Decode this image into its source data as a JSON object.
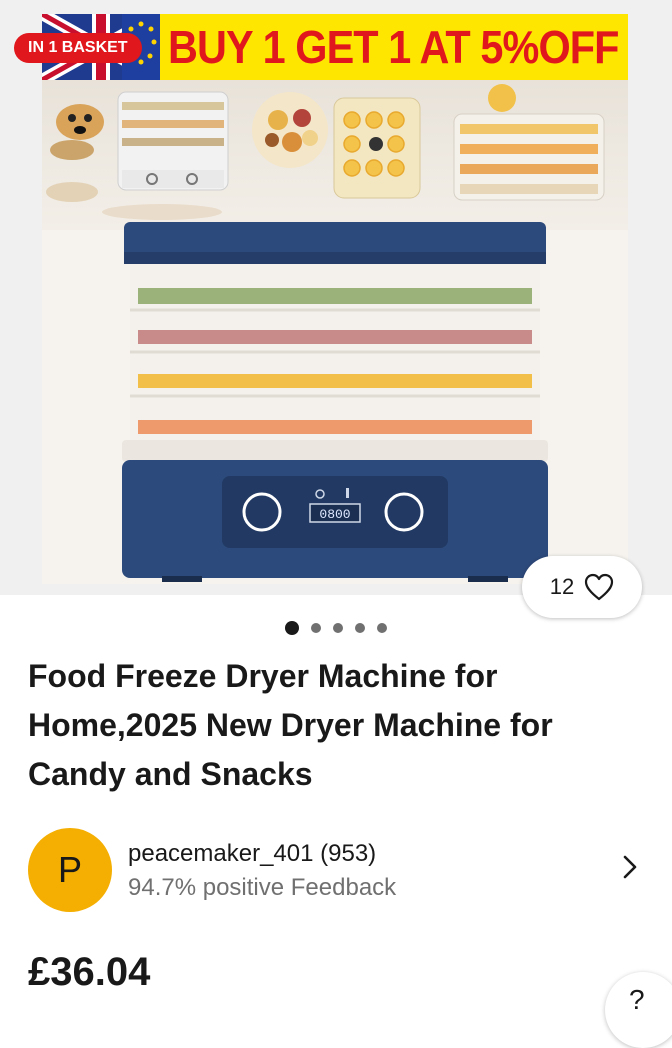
{
  "listing_image": {
    "promo_text": "BUY 1 GET 1 AT 5%OFF",
    "badge": "IN 1 BASKET",
    "display_readout": "0800",
    "watchers": "12",
    "image_count": 5,
    "active_image": 1
  },
  "product": {
    "title": "Food Freeze Dryer Machine for Home,2025 New Dryer Machine for Candy and Snacks",
    "price": "£36.04"
  },
  "seller": {
    "initial": "P",
    "name": "peacemaker_401 (953)",
    "feedback": "94.7% positive Feedback"
  },
  "help": {
    "label": "?"
  },
  "colors": {
    "accent": "#e0171c",
    "promo": "#ffe600",
    "avatar": "#f5af02",
    "text": "#191919",
    "muted": "#707070"
  }
}
